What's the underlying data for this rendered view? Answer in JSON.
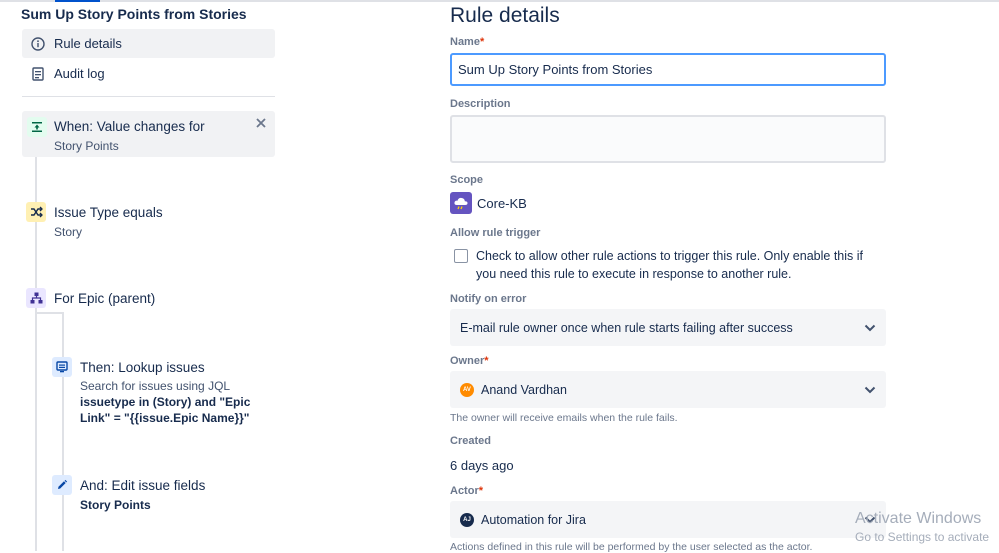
{
  "left": {
    "rule_name": "Sum Up Story Points from Stories",
    "nav": [
      {
        "label": "Rule details",
        "icon": "info-icon",
        "selected": true
      },
      {
        "label": "Audit log",
        "icon": "document-icon",
        "selected": false
      }
    ],
    "components": {
      "trigger": {
        "title": "When: Value changes for",
        "sub": "Story Points",
        "icon": "trigger-icon"
      },
      "condition": {
        "title": "Issue Type equals",
        "sub": "Story",
        "icon": "shuffle-icon"
      },
      "branch": {
        "title": "For Epic (parent)",
        "icon": "hierarchy-icon"
      },
      "lookup": {
        "title": "Then: Lookup issues",
        "sub": "Search for issues using JQL",
        "jql": "issuetype in (Story) and \"Epic Link\" = \"{{issue.Epic Name}}\"",
        "icon": "lookup-icon"
      },
      "edit": {
        "title": "And: Edit issue fields",
        "field": "Story Points",
        "icon": "pencil-icon"
      }
    }
  },
  "right": {
    "title": "Rule details",
    "name_label": "Name",
    "name_value": "Sum Up Story Points from Stories",
    "description_label": "Description",
    "description_value": "",
    "scope_label": "Scope",
    "scope_value": "Core-KB",
    "allow_trigger_label": "Allow rule trigger",
    "allow_trigger_text": "Check to allow other rule actions to trigger this rule. Only enable this if you need this rule to execute in response to another rule.",
    "notify_label": "Notify on error",
    "notify_value": "E-mail rule owner once when rule starts failing after success",
    "owner_label": "Owner",
    "owner_initials": "AV",
    "owner_value": "Anand Vardhan",
    "owner_helper": "The owner will receive emails when the rule fails.",
    "created_label": "Created",
    "created_value": "6 days ago",
    "actor_label": "Actor",
    "actor_initials": "AJ",
    "actor_value": "Automation for Jira",
    "actor_helper": "Actions defined in this rule will be performed by the user selected as the actor."
  },
  "watermark": {
    "line1": "Activate Windows",
    "line2": "Go to Settings to activate"
  },
  "colors": {
    "required": "#de350b",
    "focus_border": "#4c9aff",
    "trigger_badge": "#e3fcef",
    "condition_badge": "#fff0b3",
    "branch_badge": "#eae6ff",
    "action_badge": "#deebff"
  }
}
